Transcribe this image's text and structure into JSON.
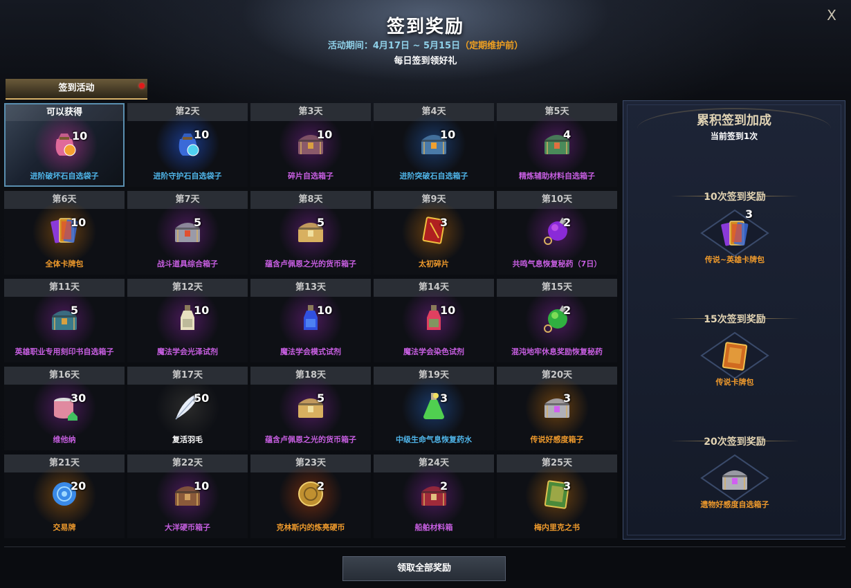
{
  "header": {
    "title": "签到奖励",
    "period_label": "活动期间：4月17日 ~ 5月15日",
    "period_note": "（定期维护前）",
    "subtitle": "每日签到领好礼",
    "close_label": "X"
  },
  "tab": {
    "label": "签到活动"
  },
  "colors": {
    "orange": "#ef9a2c",
    "blue": "#4fb4e8",
    "purple": "#c65ee0",
    "white": "#ffffff"
  },
  "days": [
    {
      "day": "可以获得",
      "name": "进阶破坏石自选袋子",
      "qty": "10",
      "color": "#4fb4e8",
      "icon": "pouch-icon",
      "art": "pouch",
      "c1": "#e06a9a",
      "c2": "#f5a030",
      "glow": "#7a2a6a"
    },
    {
      "day": "第2天",
      "name": "进阶守护石自选袋子",
      "qty": "10",
      "color": "#4fb4e8",
      "icon": "pouch-icon",
      "art": "pouch",
      "c1": "#3a6ad8",
      "c2": "#4fd0f0",
      "glow": "#1a3a8a"
    },
    {
      "day": "第3天",
      "name": "碎片自选箱子",
      "qty": "10",
      "color": "#c65ee0",
      "icon": "chest-icon",
      "art": "chest",
      "c1": "#8a5a6a",
      "c2": "#d9a040",
      "glow": "#4a1a5a"
    },
    {
      "day": "第4天",
      "name": "进阶突破石自选箱子",
      "qty": "10",
      "color": "#4fb4e8",
      "icon": "chest-icon",
      "art": "chest",
      "c1": "#4a7aa8",
      "c2": "#f0a030",
      "glow": "#1a3a6a"
    },
    {
      "day": "第5天",
      "name": "精炼辅助材料自选箱子",
      "qty": "4",
      "color": "#c65ee0",
      "icon": "chest-icon",
      "art": "chest",
      "c1": "#4a8a5a",
      "c2": "#e07040",
      "glow": "#4a1a5a"
    },
    {
      "day": "第6天",
      "name": "全体卡牌包",
      "qty": "10",
      "color": "#ef9a2c",
      "icon": "card-pack-icon",
      "art": "cards",
      "c1": "#d08a20",
      "c2": "#8a3ad8",
      "glow": "#6a4010"
    },
    {
      "day": "第7天",
      "name": "战斗道具综合箱子",
      "qty": "5",
      "color": "#c65ee0",
      "icon": "chest-icon",
      "art": "chest",
      "c1": "#9a9aa8",
      "c2": "#e05030",
      "glow": "#4a1a5a"
    },
    {
      "day": "第8天",
      "name": "蕴含卢佩恩之光的货币箱子",
      "qty": "5",
      "color": "#c65ee0",
      "icon": "chest-icon",
      "art": "chest",
      "c1": "#d8b060",
      "c2": "#f0e0a0",
      "glow": "#4a1a5a"
    },
    {
      "day": "第9天",
      "name": "太初碎片",
      "qty": "3",
      "color": "#ef9a2c",
      "icon": "card-icon",
      "art": "card",
      "c1": "#b02020",
      "c2": "#f0c040",
      "glow": "#6a4010"
    },
    {
      "day": "第10天",
      "name": "共鸣气息恢复秘药（7日）",
      "qty": "2",
      "color": "#c65ee0",
      "icon": "potion-icon",
      "art": "orb",
      "c1": "#8a2ad8",
      "c2": "#d060f0",
      "glow": "#4a1a5a"
    },
    {
      "day": "第11天",
      "name": "英雄职业专用刻印书自选箱子",
      "qty": "5",
      "color": "#c65ee0",
      "icon": "chest-icon",
      "art": "chest",
      "c1": "#3a7a8a",
      "c2": "#d8a040",
      "glow": "#4a1a5a"
    },
    {
      "day": "第12天",
      "name": "魔法学会光泽试剂",
      "qty": "10",
      "color": "#c65ee0",
      "icon": "bottle-icon",
      "art": "bottle",
      "c1": "#e8e0c0",
      "c2": "#a0a080",
      "glow": "#4a1a5a"
    },
    {
      "day": "第13天",
      "name": "魔法学会模式试剂",
      "qty": "10",
      "color": "#c65ee0",
      "icon": "bottle-icon",
      "art": "bottle",
      "c1": "#3050e0",
      "c2": "#60a0ff",
      "glow": "#4a1a5a"
    },
    {
      "day": "第14天",
      "name": "魔法学会染色试剂",
      "qty": "10",
      "color": "#c65ee0",
      "icon": "bottle-icon",
      "art": "bottle",
      "c1": "#e04060",
      "c2": "#40d060",
      "glow": "#4a1a5a"
    },
    {
      "day": "第15天",
      "name": "混沌地牢休息奖励恢复秘药",
      "qty": "2",
      "color": "#c65ee0",
      "icon": "potion-icon",
      "art": "orb",
      "c1": "#30b040",
      "c2": "#a0f060",
      "glow": "#4a1a5a"
    },
    {
      "day": "第16天",
      "name": "维他纳",
      "qty": "30",
      "color": "#c65ee0",
      "icon": "can-icon",
      "art": "can",
      "c1": "#e08aa0",
      "c2": "#40c060",
      "glow": "#4a1a5a"
    },
    {
      "day": "第17天",
      "name": "复活羽毛",
      "qty": "50",
      "color": "#ffffff",
      "icon": "feather-icon",
      "art": "feather",
      "c1": "#e8eef8",
      "c2": "#a0b0c8",
      "glow": "#2a2a2a"
    },
    {
      "day": "第18天",
      "name": "蕴含卢佩恩之光的货币箱子",
      "qty": "5",
      "color": "#c65ee0",
      "icon": "chest-icon",
      "art": "chest",
      "c1": "#d8b060",
      "c2": "#f0e0a0",
      "glow": "#4a1a5a"
    },
    {
      "day": "第19天",
      "name": "中级生命气息恢复药水",
      "qty": "3",
      "color": "#4fb4e8",
      "icon": "flask-icon",
      "art": "flask",
      "c1": "#50d050",
      "c2": "#f0e060",
      "glow": "#1a3a6a"
    },
    {
      "day": "第20天",
      "name": "传说好感度箱子",
      "qty": "3",
      "color": "#ef9a2c",
      "icon": "chest-icon",
      "art": "chest",
      "c1": "#b0b0b8",
      "c2": "#d060f0",
      "glow": "#6a4010"
    },
    {
      "day": "第21天",
      "name": "交易牌",
      "qty": "20",
      "color": "#ef9a2c",
      "icon": "disc-icon",
      "art": "disc",
      "c1": "#3a8ae8",
      "c2": "#a0d8ff",
      "glow": "#6a4010"
    },
    {
      "day": "第22天",
      "name": "大洋硬币箱子",
      "qty": "10",
      "color": "#c65ee0",
      "icon": "chest-icon",
      "art": "chest",
      "c1": "#8a5a3a",
      "c2": "#d0a060",
      "glow": "#4a1a5a"
    },
    {
      "day": "第23天",
      "name": "克林斯内的炼亮硬币",
      "qty": "2",
      "color": "#ef9a2c",
      "icon": "coin-icon",
      "art": "coin",
      "c1": "#c09030",
      "c2": "#f0d070",
      "glow": "#6a2a10"
    },
    {
      "day": "第24天",
      "name": "船舶材料箱",
      "qty": "2",
      "color": "#c65ee0",
      "icon": "chest-icon",
      "art": "chest",
      "c1": "#a02a3a",
      "c2": "#e0c080",
      "glow": "#4a1a5a"
    },
    {
      "day": "第25天",
      "name": "梅内里克之书",
      "qty": "3",
      "color": "#ef9a2c",
      "icon": "book-icon",
      "art": "book",
      "c1": "#4a8a3a",
      "c2": "#e0c050",
      "glow": "#6a4010"
    }
  ],
  "sidebar": {
    "title": "累积签到加成",
    "current": "当前签到1次",
    "milestones": [
      {
        "label": "10次签到奖励",
        "name": "传说~英雄卡牌包",
        "qty": "3",
        "icon": "card-pack-icon",
        "art": "cards",
        "c1": "#d08a20",
        "c2": "#8a3ad8"
      },
      {
        "label": "15次签到奖励",
        "name": "传说卡牌包",
        "qty": "",
        "icon": "card-pack-unknown-icon",
        "art": "book",
        "c1": "#d06a20",
        "c2": "#f0c050"
      },
      {
        "label": "20次签到奖励",
        "name": "遗物好感度自选箱子",
        "qty": "",
        "icon": "chest-icon",
        "art": "chest",
        "c1": "#b0b0b8",
        "c2": "#d060f0"
      }
    ]
  },
  "footer": {
    "claim_label": "领取全部奖励"
  }
}
